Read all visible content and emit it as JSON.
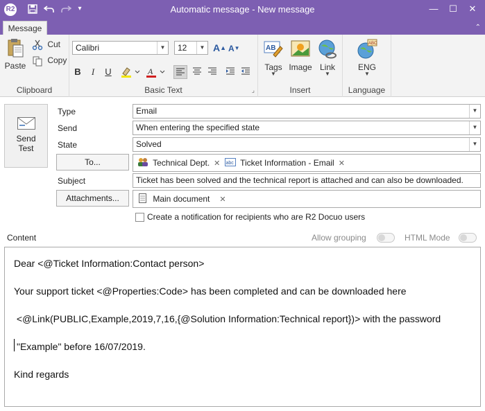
{
  "window": {
    "app_logo": "R2",
    "title": "Automatic message - New message",
    "minimize_glyph": "—",
    "maximize_glyph": "☐",
    "close_glyph": "✕"
  },
  "quick_access": {
    "save_glyph": "💾",
    "undo_glyph": "↶",
    "redo_glyph": "↷",
    "customize_glyph": "▾"
  },
  "ribbon": {
    "tabs": [
      {
        "label": "Message"
      }
    ],
    "collapse_glyph": "⌃",
    "groups": {
      "clipboard": {
        "label": "Clipboard",
        "paste": "Paste",
        "cut": "Cut",
        "copy": "Copy"
      },
      "basic_text": {
        "label": "Basic Text",
        "font_name": "Calibri",
        "font_size": "12",
        "grow_font": "A",
        "shrink_font": "A",
        "bold": "B",
        "italic": "I",
        "underline": "U",
        "dialog_launcher": "⌟"
      },
      "insert": {
        "label": "Insert",
        "tags": "Tags",
        "image": "Image",
        "link": "Link"
      },
      "language": {
        "label": "Language",
        "current": "ENG"
      }
    }
  },
  "form": {
    "send_test": {
      "line1": "Send",
      "line2": "Test"
    },
    "type": {
      "label": "Type",
      "value": "Email"
    },
    "send": {
      "label": "Send",
      "value": "When entering the specified state"
    },
    "state": {
      "label": "State",
      "value": "Solved"
    },
    "to": {
      "button": "To...",
      "recipients": [
        {
          "name": "Technical Dept.",
          "icon": "group-icon"
        },
        {
          "name": "Ticket Information - Email",
          "icon": "field-abc-icon"
        }
      ]
    },
    "subject": {
      "label": "Subject",
      "value": "Ticket has been solved and the technical report is attached and can also be downloaded."
    },
    "attachments": {
      "button": "Attachments...",
      "items": [
        {
          "name": "Main document",
          "icon": "document-icon"
        }
      ]
    },
    "notification_checkbox": {
      "label": "Create a notification for recipients who are R2 Docuo users",
      "checked": false
    }
  },
  "content": {
    "label": "Content",
    "allow_grouping": {
      "label": "Allow grouping",
      "on": false
    },
    "html_mode": {
      "label": "HTML Mode",
      "on": false
    },
    "body_lines": [
      "Dear <@Ticket Information:Contact person>",
      "Your support ticket <@Properties:Code> has been completed and can be downloaded here",
      " <@Link(PUBLIC,Example,2019,7,16,{@Solution Information:Technical report})> with the password",
      "\"Example\" before 16/07/2019.",
      "Kind regards"
    ]
  },
  "colors": {
    "titlebar": "#7d5fb2",
    "ribbon_bg": "#f3f3f3",
    "border": "#a9a9a9"
  }
}
